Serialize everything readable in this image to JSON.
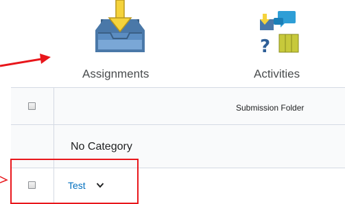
{
  "tools": {
    "assignments_label": "Assignments",
    "activities_label": "Activities"
  },
  "table": {
    "header": {
      "column_label": "Submission Folder"
    },
    "category_row": {
      "label": "No Category"
    },
    "item_row": {
      "label": "Test"
    }
  },
  "colors": {
    "accent_link": "#006fbf",
    "annotation_red": "#e8161b",
    "row_bg": "#f9fafb",
    "border": "#d3d9e3"
  },
  "icons": {
    "assignments": "inbox-tray-down-arrow-icon",
    "activities": "activities-grid-icon",
    "row_menu": "chevron-down-icon"
  }
}
